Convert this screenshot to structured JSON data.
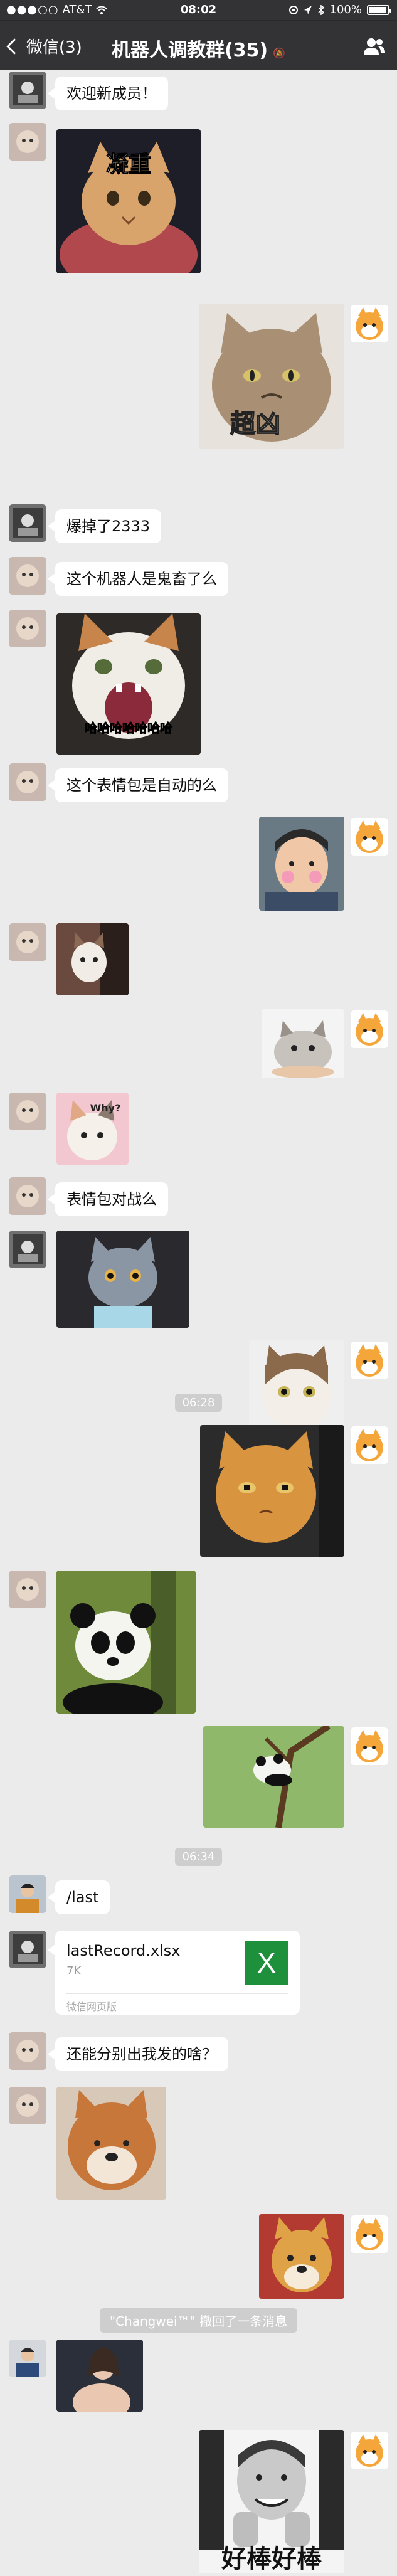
{
  "status_bar": {
    "signal": "●●●○○",
    "carrier": "AT&T",
    "time": "08:02",
    "battery": "100%"
  },
  "nav": {
    "back_label": "微信(3)",
    "title": "机器人调教群(35)",
    "mute_glyph": "🔕"
  },
  "messages": {
    "m1": "欢迎新成员！",
    "m3_caption": "凝重",
    "m4_caption": "超凶",
    "m5": "爆掉了2333",
    "m6": "这个机器人是鬼畜了么",
    "m7_caption": "哈哈哈哈哈哈哈",
    "m8": "这个表情包是自动的么",
    "m12_caption": "Why?",
    "m13": "表情包对战么",
    "time1": "06:28",
    "time2": "06:34",
    "m20": "/last",
    "file": {
      "name": "lastRecord.xlsx",
      "size": "7K",
      "icon": "X",
      "source": "微信网页版"
    },
    "m22": "还能分别出我发的啥？",
    "recall": "\"Changwei™\" 撤回了一条消息",
    "m26_caption": "好棒好棒"
  }
}
